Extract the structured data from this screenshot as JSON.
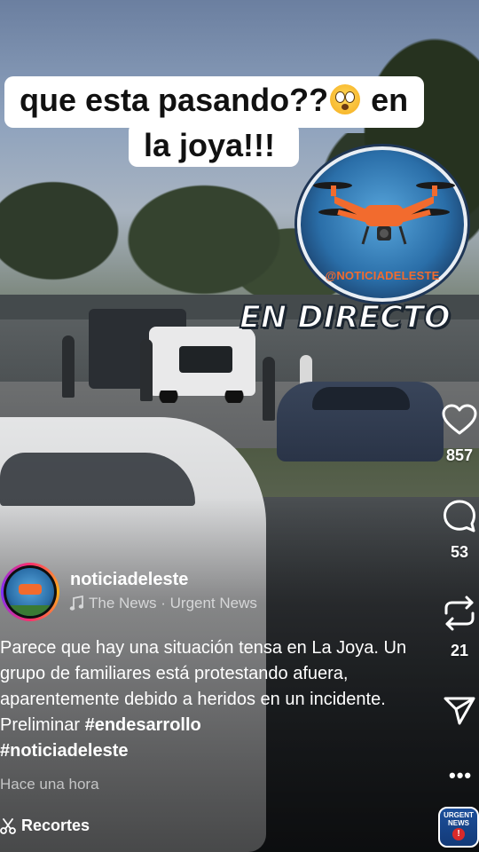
{
  "overlay": {
    "caption_line1": "que esta pasando??",
    "caption_line1_end": "en",
    "caption_line2": "la joya!!!",
    "emoji": "flushed-face",
    "logo_handle": "@NOTICIADELESTE",
    "live_banner": "EN DIRECTO"
  },
  "actions": {
    "likes": "857",
    "comments": "53",
    "reposts": "21",
    "icons": [
      "heart-icon",
      "comment-icon",
      "repost-icon",
      "share-icon",
      "more-icon"
    ]
  },
  "author": {
    "username": "noticiadeleste",
    "audio": "The News · Urgent News"
  },
  "post": {
    "caption_text": "Parece que hay una situación tensa en La Joya. Un grupo de familiares está protestando afuera, aparentemente debido a heridos en un incidente.  Preliminar ",
    "hashtag1": "#endesarrollo",
    "hashtag2": "#noticiadeleste",
    "time_ago": "Hace una hora",
    "clips_label": "Recortes"
  },
  "audio_badge": {
    "line1": "URGENT",
    "line2": "NEWS",
    "mark": "!"
  },
  "colors": {
    "accent_orange": "#f26b2e",
    "badge_blue": "#1c4f9b"
  }
}
